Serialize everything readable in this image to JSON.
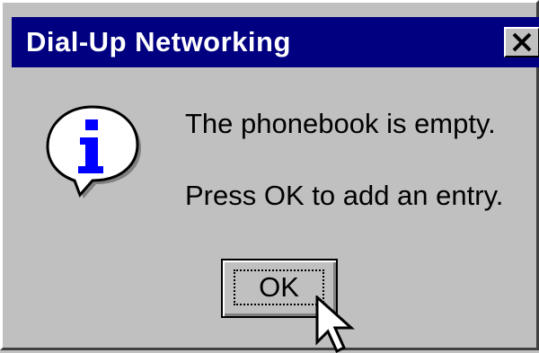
{
  "dialog": {
    "title": "Dial-Up Networking",
    "close_icon": "close-icon",
    "icon": "information-icon",
    "message_line1": "The phonebook is empty.",
    "message_line2": "Press OK to add an entry.",
    "ok_label": "OK"
  },
  "colors": {
    "titlebar": "#000080",
    "face": "#c0c0c0",
    "icon_glyph": "#0000ff"
  },
  "cursor": "arrow-cursor-icon"
}
